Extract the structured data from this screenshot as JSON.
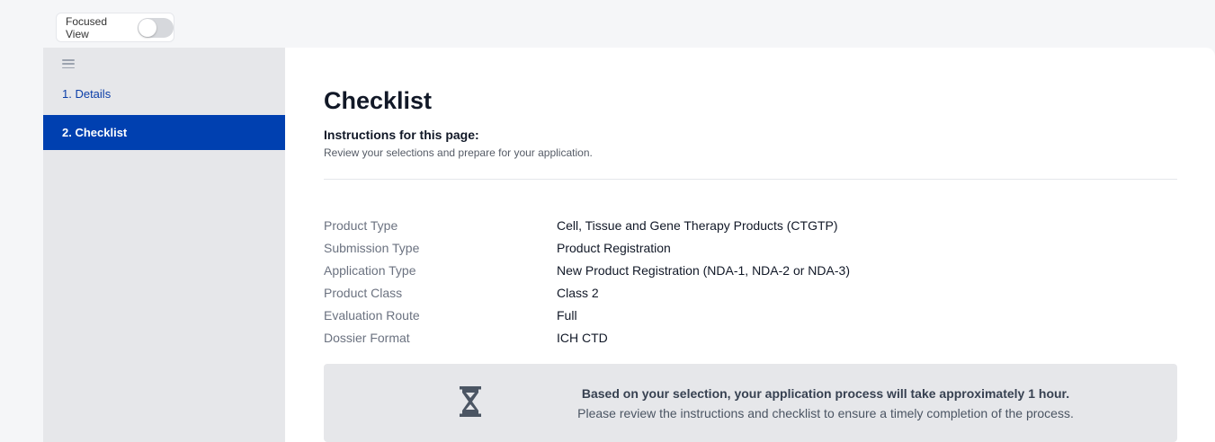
{
  "topbar": {
    "focused_view_label": "Focused View",
    "focused_view_on": false
  },
  "sidebar": {
    "items": [
      {
        "label": "1. Details",
        "active": false
      },
      {
        "label": "2. Checklist",
        "active": true
      }
    ]
  },
  "main": {
    "title": "Checklist",
    "instructions_heading": "Instructions for this page:",
    "instructions_text": "Review your selections and prepare for your application.",
    "summary": [
      {
        "label": "Product Type",
        "value": "Cell, Tissue and Gene Therapy Products (CTGTP)"
      },
      {
        "label": "Submission Type",
        "value": "Product Registration"
      },
      {
        "label": "Application Type",
        "value": "New Product Registration (NDA-1, NDA-2 or NDA-3)"
      },
      {
        "label": "Product Class",
        "value": "Class 2"
      },
      {
        "label": "Evaluation Route",
        "value": "Full"
      },
      {
        "label": "Dossier Format",
        "value": "ICH CTD"
      }
    ],
    "notice": {
      "icon": "hourglass-icon",
      "line1": "Based on your selection, your application process will take approximately 1 hour.",
      "line2": "Please review the instructions and checklist to ensure a timely completion of the process."
    }
  },
  "colors": {
    "accent": "#0040b0",
    "sidebar_bg": "#e6e7ea",
    "page_bg": "#f5f6f8"
  }
}
